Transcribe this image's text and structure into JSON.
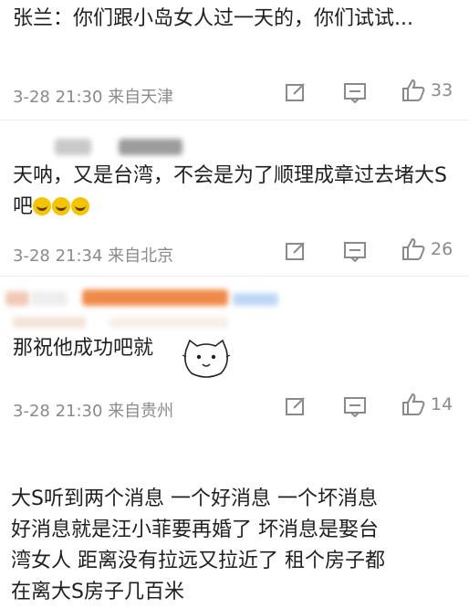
{
  "comments": [
    {
      "author": "张兰",
      "text": "：你们跟小岛女人过一天的，你们试试...",
      "meta": "3-28 21:30 来自天津",
      "likes": "33"
    },
    {
      "author": "",
      "text": "天呐，又是台湾，不会是为了顺理成章过去堵大S吧",
      "meta": "3-28 21:34 来自北京",
      "likes": "26"
    },
    {
      "author": "",
      "text": "那祝他成功吧就",
      "meta": "3-28 21:30 来自贵州",
      "likes": "14"
    }
  ],
  "post": {
    "lines": [
      "大S听到两个消息  一个好消息  一个坏消息",
      "好消息就是汪小菲要再婚了  坏消息是娶台",
      "湾女人  距离没有拉远又拉近了  租个房子都",
      "在离大S房子几百米"
    ]
  },
  "icons": [
    "share-icon",
    "comment-icon",
    "like-icon"
  ]
}
